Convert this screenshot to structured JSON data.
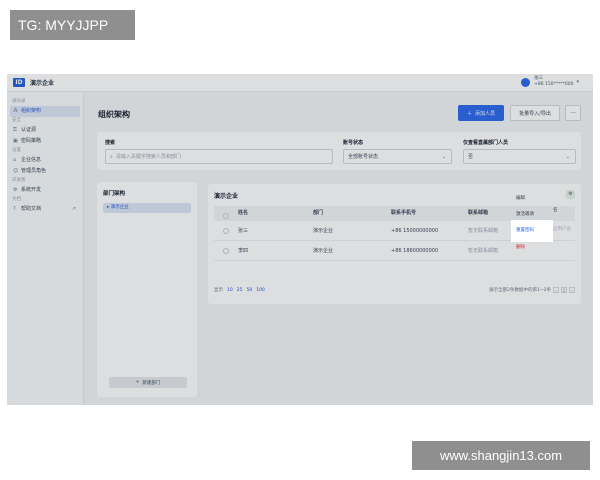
{
  "watermarks": {
    "top": "TG: MYYJJPP",
    "bottom": "www.shangjin13.com"
  },
  "app": {
    "logo": "ID",
    "name": "演示企业",
    "user": {
      "name": "张三",
      "phone": "+86 150*****000"
    }
  },
  "sidebar": {
    "groups": [
      {
        "label": "通讯录",
        "items": [
          {
            "label": "组织架构",
            "icon": "org-icon",
            "active": true
          }
        ]
      },
      {
        "label": "安全",
        "items": [
          {
            "label": "认证源",
            "icon": "key-icon"
          },
          {
            "label": "密码策略",
            "icon": "lock-icon"
          }
        ]
      },
      {
        "label": "设置",
        "items": [
          {
            "label": "企业信息",
            "icon": "building-icon"
          },
          {
            "label": "管理员角色",
            "icon": "user-icon"
          }
        ]
      },
      {
        "label": "开发者",
        "items": [
          {
            "label": "系统开发",
            "icon": "code-icon"
          }
        ]
      },
      {
        "label": "文档",
        "items": [
          {
            "label": "帮助文档",
            "icon": "help-icon"
          }
        ]
      }
    ]
  },
  "main": {
    "title": "组织架构",
    "add_member": "添加人员",
    "batch": "批量导入/导出",
    "more": "···"
  },
  "filters": {
    "search": {
      "label": "搜索",
      "placeholder": "请输入关键字搜索人员和部门"
    },
    "status": {
      "label": "账号状态",
      "value": "全部账号状态"
    },
    "direct": {
      "label": "仅查看直属部门人员",
      "value": "否"
    }
  },
  "dept": {
    "title": "部门架构",
    "selected": "演示企业",
    "new_dept": "新建部门"
  },
  "table": {
    "title": "演示企业",
    "columns": [
      "姓名",
      "部门",
      "联系手机号",
      "联系邮箱",
      "操作"
    ],
    "rows": [
      {
        "name": "张三",
        "dept": "演示企业",
        "phone": "+86 15000000000",
        "email": "暂无联系邮箱"
      },
      {
        "name": "李四",
        "dept": "演示企业",
        "phone": "+86 18600000000",
        "email": "暂无联系邮箱"
      }
    ],
    "pager": {
      "label": "显示",
      "sizes": [
        "10",
        "25",
        "50",
        "100"
      ],
      "summary": "展示全部2条数据中的第1~2条",
      "page": "1"
    }
  },
  "popup": {
    "items": [
      "编辑",
      "激活邀请",
      "重置密码",
      "删除"
    ],
    "side": [
      "名",
      "启用户名"
    ]
  }
}
